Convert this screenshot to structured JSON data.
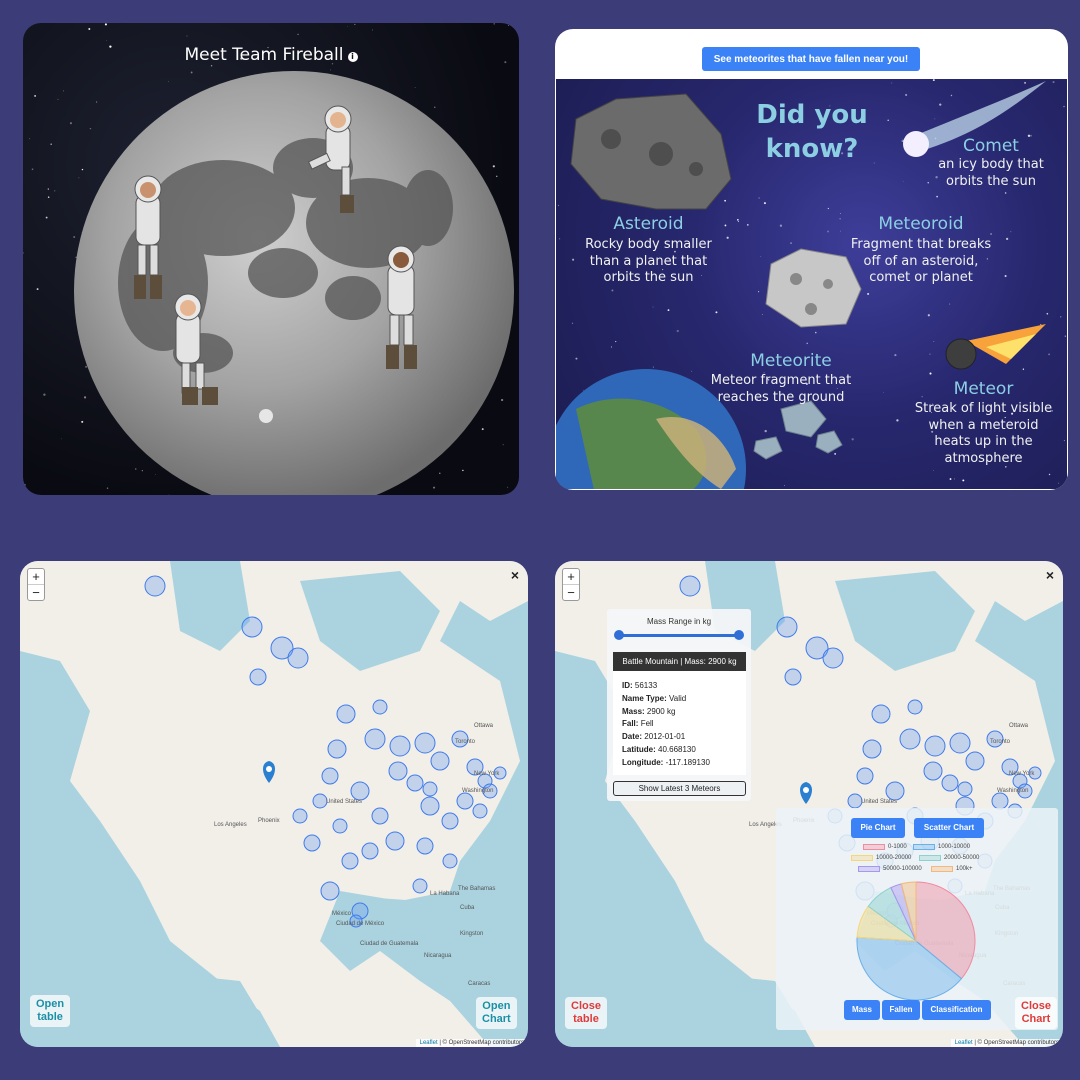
{
  "panel1": {
    "title": "Meet Team Fireball",
    "info_icon": "info-icon"
  },
  "panel2": {
    "button": "See meteorites that have fallen near you!",
    "heading_1": "Did you",
    "heading_2": "know?",
    "comet": {
      "title": "Comet",
      "lines": [
        "an icy body that",
        "orbits the sun"
      ]
    },
    "asteroid": {
      "title": "Asteroid",
      "lines": [
        "Rocky body smaller",
        "than a planet that",
        "orbits the sun"
      ]
    },
    "meteoroid": {
      "title": "Meteoroid",
      "lines": [
        "Fragment that breaks",
        "off of an asteroid,",
        "comet or planet"
      ]
    },
    "meteorite": {
      "title": "Meteorite",
      "lines": [
        "Meteor fragment that",
        "reaches the ground"
      ]
    },
    "meteor": {
      "title": "Meteor",
      "lines": [
        "Streak of light visible",
        "when a meteroid",
        "heats up in the",
        "atmosphere"
      ]
    }
  },
  "map": {
    "zoom_in": "+",
    "zoom_out": "−",
    "close": "×",
    "attribution_leaflet": "Leaflet",
    "attribution_osm": "| © OpenStreetMap contributors",
    "labels": [
      "Ottawa",
      "Toronto",
      "New York",
      "Washington",
      "Los Angeles",
      "Phoenix",
      "United States",
      "The Bahamas",
      "La Habana",
      "Cuba",
      "México",
      "Ciudad de México",
      "Ciudad de Guatemala",
      "Nicaragua",
      "Kingston",
      "Caracas"
    ]
  },
  "panel3": {
    "open_table_1": "Open",
    "open_table_2": "table",
    "open_chart_1": "Open",
    "open_chart_2": "Chart"
  },
  "panel4": {
    "mass_range_label": "Mass Range in kg",
    "mass_range": {
      "min_fraction": 0.0,
      "max_fraction": 1.0
    },
    "popup_header": "Battle Mountain | Mass: 2900 kg",
    "details": [
      {
        "label": "ID:",
        "value": "56133"
      },
      {
        "label": "Name Type:",
        "value": "Valid"
      },
      {
        "label": "Mass:",
        "value": "2900 kg"
      },
      {
        "label": "Fall:",
        "value": "Fell"
      },
      {
        "label": "Date:",
        "value": "2012-01-01"
      },
      {
        "label": "Latitude:",
        "value": "40.668130"
      },
      {
        "label": "Longitude:",
        "value": "-117.189130"
      }
    ],
    "latest_button": "Show Latest 3 Meteors",
    "pie_button": "Pie Chart",
    "scatter_button": "Scatter Chart",
    "mass_button": "Mass",
    "fallen_button": "Fallen",
    "classification_button": "Classification",
    "close_table_1": "Close",
    "close_table_2": "table",
    "close_chart_1": "Close",
    "close_chart_2": "Chart"
  },
  "chart_data": {
    "type": "pie",
    "categories": [
      "0-1000",
      "1000-10000",
      "10000-20000",
      "20000-50000",
      "50000-100000",
      "100k+"
    ],
    "colors": [
      "#f28aa0",
      "#6ab0ea",
      "#f5d67a",
      "#8fd1cf",
      "#a996f0",
      "#f5b878"
    ],
    "values": [
      36,
      40,
      9,
      8,
      3,
      4
    ]
  }
}
